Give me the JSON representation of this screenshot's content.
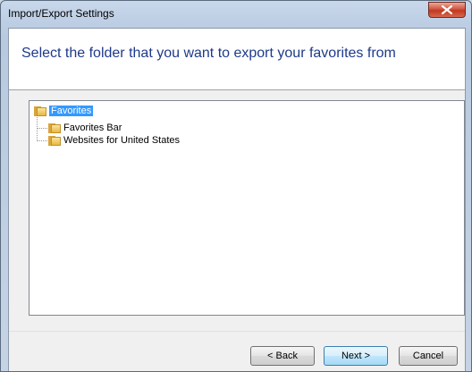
{
  "window": {
    "title": "Import/Export Settings"
  },
  "header": {
    "title": "Select the folder that you want to export your favorites from"
  },
  "tree": {
    "root": {
      "label": "Favorites",
      "selected": true
    },
    "children": [
      {
        "label": "Favorites Bar"
      },
      {
        "label": "Websites for United States"
      }
    ]
  },
  "buttons": {
    "back": "< Back",
    "next": "Next >",
    "cancel": "Cancel"
  },
  "colors": {
    "selection": "#3399ff",
    "header_text": "#1e3a8a"
  }
}
